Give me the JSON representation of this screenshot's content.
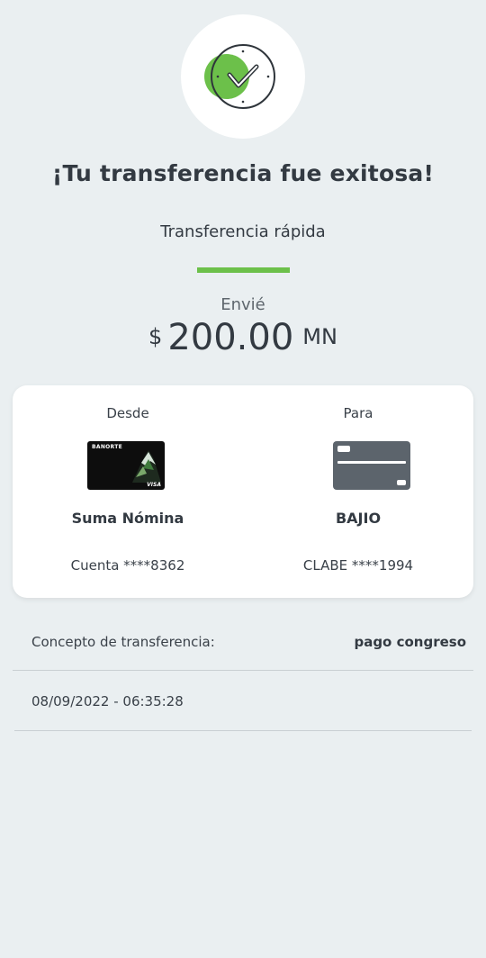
{
  "header": {
    "title": "¡Tu transferencia fue exitosa!",
    "subtitle": "Transferencia rápida"
  },
  "amount": {
    "label": "Envié",
    "currency_symbol": "$",
    "value": "200.00",
    "unit": "MN"
  },
  "transfer": {
    "from": {
      "label": "Desde",
      "card_brand": "BANORTE",
      "card_network": "VISA",
      "name": "Suma Nómina",
      "account": "Cuenta ****8362"
    },
    "to": {
      "label": "Para",
      "name": "BAJIO",
      "account": "CLABE ****1994"
    }
  },
  "details": {
    "concept_label": "Concepto de transferencia:",
    "concept_value": "pago congreso",
    "datetime": "08/09/2022 - 06:35:28"
  },
  "icons": {
    "success": "clock-check-icon",
    "destination_card": "credit-card-icon"
  },
  "colors": {
    "accent_green": "#6cc04a",
    "background": "#eaeff1",
    "card_gray": "#5c646c"
  }
}
